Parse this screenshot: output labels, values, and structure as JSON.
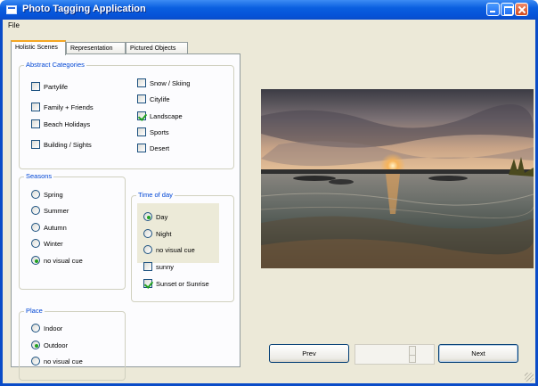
{
  "window": {
    "title": "Photo Tagging Application",
    "colors": {
      "titlebar": "#0a5fe0",
      "face": "#ece9d8",
      "accent_text": "#0046d5",
      "check": "#21a121"
    }
  },
  "menu": {
    "file": "File"
  },
  "tabs": [
    {
      "label": "Holistic Scenes",
      "active": true
    },
    {
      "label": "Representation",
      "active": false
    },
    {
      "label": "Pictured Objects",
      "active": false
    }
  ],
  "abstract_categories": {
    "title": "Abstract Categories",
    "left": [
      {
        "label": "Partylife",
        "checked": false
      },
      {
        "label": "Family + Friends",
        "checked": false
      },
      {
        "label": "Beach Holidays",
        "checked": false
      },
      {
        "label": "Building / Sights",
        "checked": false
      }
    ],
    "right": [
      {
        "label": "Snow / Skiing",
        "checked": false
      },
      {
        "label": "Citylife",
        "checked": false
      },
      {
        "label": "Landscape",
        "checked": true
      },
      {
        "label": "Sports",
        "checked": false
      },
      {
        "label": "Desert",
        "checked": false
      }
    ]
  },
  "seasons": {
    "title": "Seasons",
    "options": [
      {
        "label": "Spring",
        "selected": false
      },
      {
        "label": "Summer",
        "selected": false
      },
      {
        "label": "Autumn",
        "selected": false
      },
      {
        "label": "Winter",
        "selected": false
      },
      {
        "label": "no visual cue",
        "selected": true
      }
    ]
  },
  "time_of_day": {
    "title": "Time of day",
    "options": [
      {
        "label": "Day",
        "selected": true
      },
      {
        "label": "Night",
        "selected": false
      },
      {
        "label": "no visual cue",
        "selected": false
      }
    ],
    "checks": [
      {
        "label": "sunny",
        "checked": false
      },
      {
        "label": "Sunset or Sunrise",
        "checked": true
      }
    ]
  },
  "place": {
    "title": "Place",
    "options": [
      {
        "label": "Indoor",
        "selected": false
      },
      {
        "label": "Outdoor",
        "selected": true
      },
      {
        "label": "no visual cue",
        "selected": false
      }
    ]
  },
  "navigation": {
    "prev": "Prev",
    "next": "Next"
  },
  "image": {
    "icon": "landscape-photo"
  }
}
